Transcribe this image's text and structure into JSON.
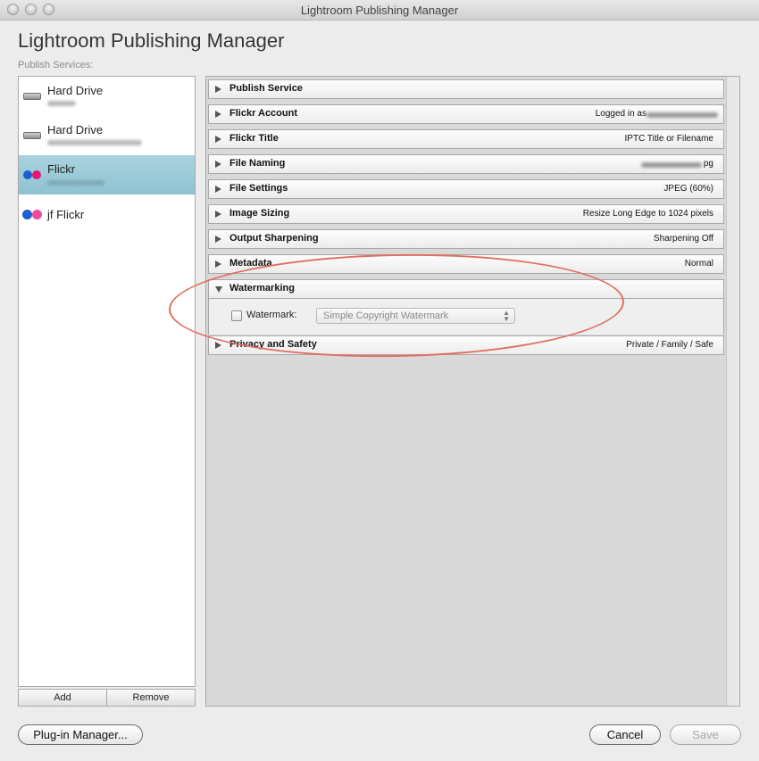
{
  "window": {
    "title": "Lightroom Publishing Manager"
  },
  "header": {
    "title": "Lightroom Publishing Manager",
    "subtitle": "Publish Services:"
  },
  "services": [
    {
      "name": "Hard Drive",
      "icon": "hard-drive-icon"
    },
    {
      "name": "Hard Drive",
      "icon": "hard-drive-icon"
    },
    {
      "name": "Flickr",
      "icon": "flickr-icon",
      "selected": true
    },
    {
      "name": "jf Flickr",
      "icon": "flickr-icon"
    }
  ],
  "service_buttons": {
    "add": "Add",
    "remove": "Remove"
  },
  "sections": [
    {
      "title": "Publish Service",
      "summary": ""
    },
    {
      "title": "Flickr Account",
      "summary": "Logged in as"
    },
    {
      "title": "Flickr Title",
      "summary": "IPTC Title or Filename"
    },
    {
      "title": "File Naming",
      "summary": "pg"
    },
    {
      "title": "File Settings",
      "summary": "JPEG (60%)"
    },
    {
      "title": "Image Sizing",
      "summary": "Resize Long Edge to 1024 pixels"
    },
    {
      "title": "Output Sharpening",
      "summary": "Sharpening Off"
    },
    {
      "title": "Metadata",
      "summary": "Normal"
    },
    {
      "title": "Watermarking",
      "summary": "",
      "expanded": true
    },
    {
      "title": "Privacy and Safety",
      "summary": "Private / Family / Safe"
    }
  ],
  "watermark": {
    "label": "Watermark:",
    "checked": false,
    "selected_option": "Simple Copyright Watermark"
  },
  "footer": {
    "plugin_manager": "Plug-in Manager...",
    "cancel": "Cancel",
    "save": "Save"
  },
  "colors": {
    "selection": "#9fcbd8",
    "flickr_blue": "#1d5fd1",
    "flickr_pink": "#e6157b",
    "jf_pink": "#f04c9b",
    "annotation": "#e07060"
  }
}
